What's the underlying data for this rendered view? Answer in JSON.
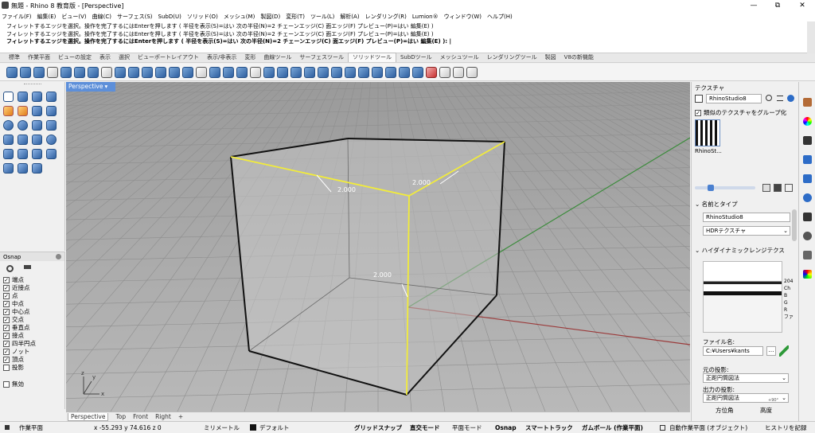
{
  "window": {
    "title": "無題 - Rhino 8 教育版 - [Perspective]",
    "minimize": "—",
    "maximize": "⧉",
    "close": "✕"
  },
  "menu": [
    "ファイル(F)",
    "編集(E)",
    "ビュー(V)",
    "曲線(C)",
    "サーフェス(S)",
    "SubD(U)",
    "ソリッド(O)",
    "メッシュ(M)",
    "製図(D)",
    "変形(T)",
    "ツール(L)",
    "解析(A)",
    "レンダリング(R)",
    "Lumion®",
    "ウィンドウ(W)",
    "ヘルプ(H)"
  ],
  "command": {
    "lines": [
      "フィレットするエッジを選択。操作を完了するにはEnterを押します ( 半径を表示(S)=はい  次の半径(N)=2  チェーンエッジ(C)  面エッジ(F)  プレビュー(P)=はい  編集(E) )",
      "フィレットするエッジを選択。操作を完了するにはEnterを押します ( 半径を表示(S)=はい  次の半径(N)=2  チェーンエッジ(C)  面エッジ(F)  プレビュー(P)=はい  編集(E) )"
    ],
    "current": "フィレットするエッジを選択。操作を完了するにはEnterを押します ( 半径を表示(S)=はい  次の半径(N)=2  チェーンエッジ(C)  面エッジ(F)  プレビュー(P)=はい  編集(E) ): |"
  },
  "toolbar_tabs": [
    "標準",
    "作業平面",
    "ビューの設定",
    "表示",
    "選択",
    "ビューポートレイアウト",
    "表示/非表示",
    "変形",
    "曲線ツール",
    "サーフェスツール",
    "ソリッドツール",
    "SubDツール",
    "メッシュツール",
    "レンダリングツール",
    "製図",
    "V8の新機能"
  ],
  "active_tab": "ソリッドツール",
  "osnap": {
    "title": "Osnap",
    "items": [
      {
        "label": "端点",
        "checked": true
      },
      {
        "label": "近接点",
        "checked": true
      },
      {
        "label": "点",
        "checked": true
      },
      {
        "label": "中点",
        "checked": true
      },
      {
        "label": "中心点",
        "checked": true
      },
      {
        "label": "交点",
        "checked": true
      },
      {
        "label": "垂直点",
        "checked": true
      },
      {
        "label": "接点",
        "checked": true
      },
      {
        "label": "四半円点",
        "checked": true
      },
      {
        "label": "ノット",
        "checked": true
      },
      {
        "label": "頂点",
        "checked": true
      },
      {
        "label": "投影",
        "checked": false
      }
    ],
    "disable": "無効"
  },
  "viewport": {
    "name": "Perspective",
    "dims": [
      "2.000",
      "2.000",
      "2.000"
    ],
    "tabs": [
      "Perspective",
      "Top",
      "Front",
      "Right"
    ],
    "add": "+",
    "axis_x": "x",
    "axis_y": "y",
    "axis_z": "z"
  },
  "texture_panel": {
    "title": "テクスチャ",
    "search_value": "RhinoStudio8",
    "group_similar": "類似のテクスチャをグループ化",
    "thumb_label": "RhinoSt...",
    "name_type_section": "名前とタイプ",
    "name_value": "RhinoStudio8",
    "type_value": "HDRテクスチャ",
    "hdr_section": "ハイダイナミックレンジテクス",
    "side_labels": [
      "204",
      "Ch",
      "B",
      "G",
      "R",
      "ファ"
    ],
    "file_name_label": "ファイル名:",
    "file_name_value": "C:¥Users¥kants",
    "source_proj_label": "元の投影:",
    "source_proj_value": "正距円筒図法",
    "output_proj_label": "出力の投影:",
    "output_proj_value": "正距円筒図法",
    "azimuth": "方位角",
    "altitude": "高度",
    "deg": "+90°"
  },
  "status": {
    "cplane": "作業平面",
    "coords": "x -55.293   y 74.616   z 0",
    "units": "ミリメートル",
    "layer": "デフォルト",
    "grid_snap": "グリッドスナップ",
    "ortho": "直交モード",
    "planar": "平面モード",
    "osnap": "Osnap",
    "smarttrack": "スマートトラック",
    "gumball": "ガムボール (作業平面)",
    "auto_cplane": "自動作業平面 (オブジェクト)",
    "history": "ヒストリを記録"
  }
}
